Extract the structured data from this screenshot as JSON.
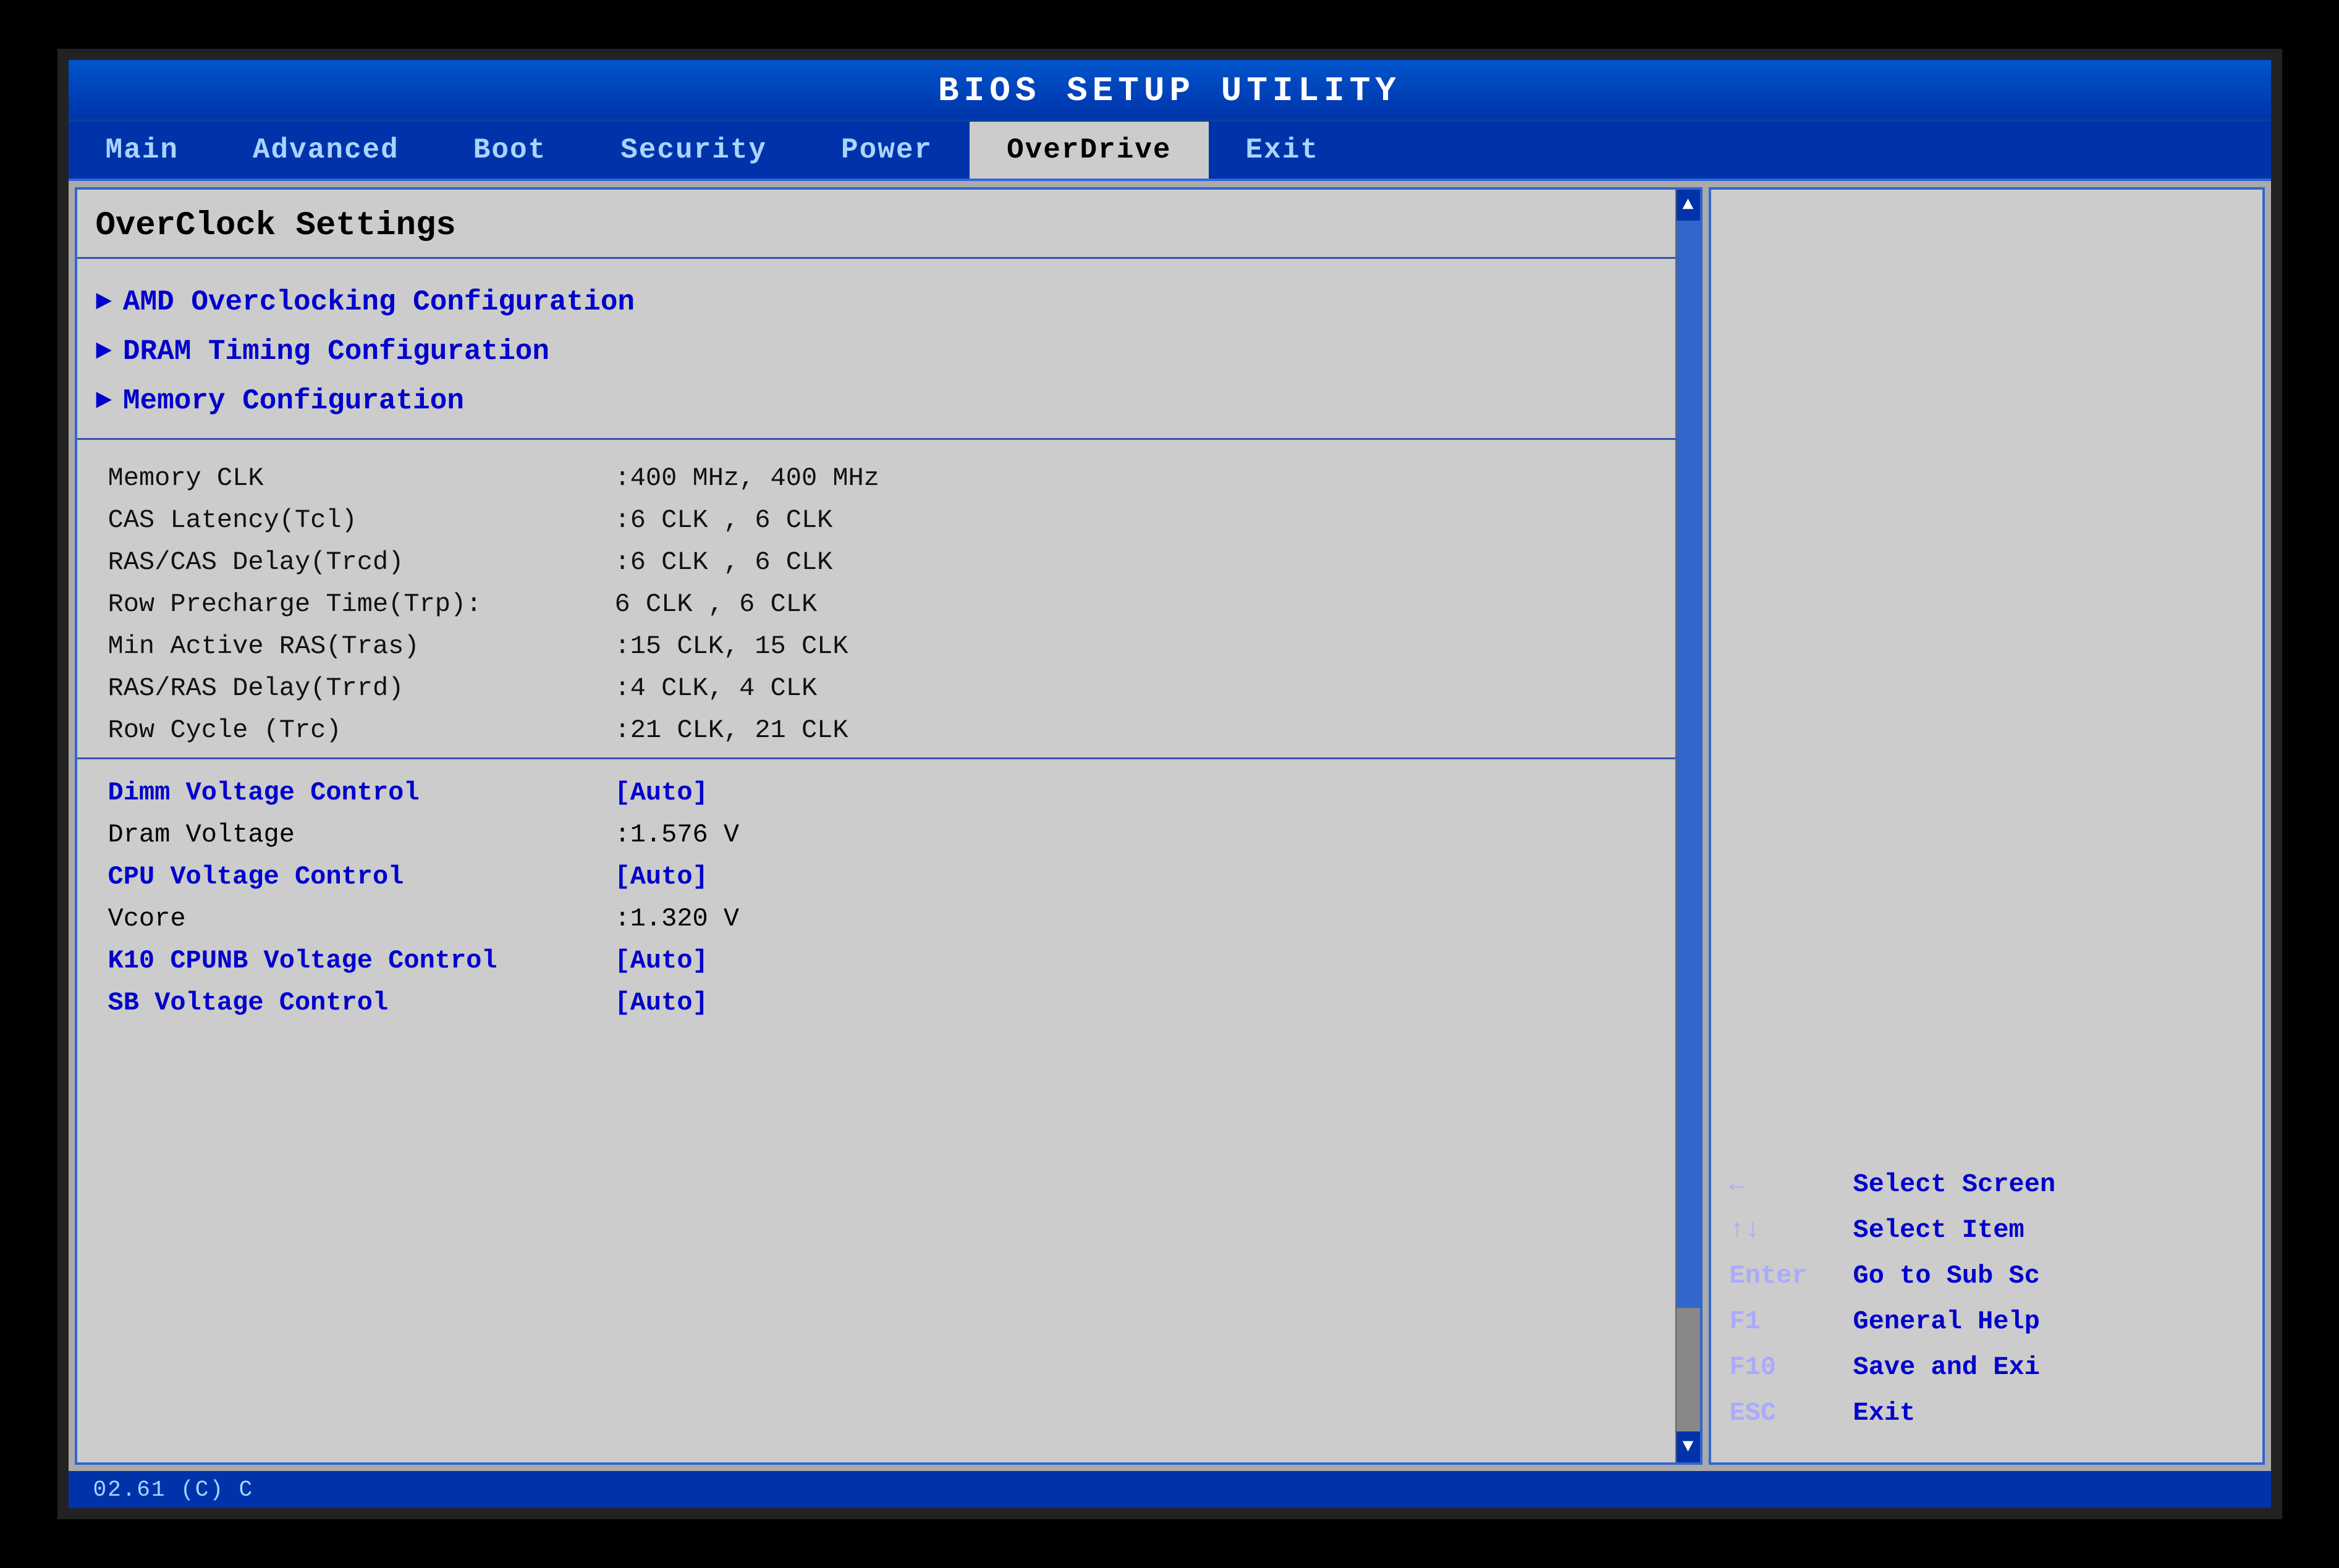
{
  "title": "BIOS SETUP UTILITY",
  "nav": {
    "tabs": [
      {
        "label": "Main",
        "active": false
      },
      {
        "label": "Advanced",
        "active": false
      },
      {
        "label": "Boot",
        "active": false
      },
      {
        "label": "Security",
        "active": false
      },
      {
        "label": "Power",
        "active": false
      },
      {
        "label": "OverDrive",
        "active": true
      },
      {
        "label": "Exit",
        "active": false
      }
    ]
  },
  "main_panel": {
    "title": "OverClock Settings",
    "submenus": [
      {
        "label": "AMD Overclocking Configuration"
      },
      {
        "label": "DRAM Timing Configuration"
      },
      {
        "label": "Memory Configuration"
      }
    ],
    "settings": [
      {
        "label": "Memory CLK",
        "value": ":400 MHz, 400 MHz"
      },
      {
        "label": "CAS Latency(Tcl)",
        "value": ":6 CLK , 6 CLK"
      },
      {
        "label": "RAS/CAS Delay(Trcd)",
        "value": ":6 CLK , 6 CLK"
      },
      {
        "label": "Row Precharge Time(Trp):",
        "value": "6 CLK , 6 CLK"
      },
      {
        "label": "Min Active RAS(Tras)",
        "value": ":15 CLK, 15 CLK"
      },
      {
        "label": "RAS/RAS Delay(Trrd)",
        "value": ":4 CLK, 4 CLK"
      },
      {
        "label": "Row Cycle (Trc)",
        "value": ":21 CLK, 21 CLK"
      }
    ],
    "voltages": [
      {
        "label": "Dimm Voltage Control",
        "value": "[Auto]",
        "label_blue": true,
        "value_blue": true
      },
      {
        "label": "Dram Voltage",
        "value": ":1.576 V",
        "label_blue": false,
        "value_blue": false
      },
      {
        "label": "CPU Voltage Control",
        "value": "[Auto]",
        "label_blue": true,
        "value_blue": true
      },
      {
        "label": "Vcore",
        "value": ":1.320 V",
        "label_blue": false,
        "value_blue": false
      },
      {
        "label": "K10 CPUNB Voltage Control",
        "value": "[Auto]",
        "label_blue": true,
        "value_blue": true
      },
      {
        "label": "SB Voltage Control",
        "value": "[Auto]",
        "label_blue": true,
        "value_blue": true
      }
    ]
  },
  "legend": [
    {
      "key": "←",
      "desc": "Select Screen"
    },
    {
      "key": "↑↓",
      "desc": "Select Item"
    },
    {
      "key": "Enter",
      "desc": "Go to Sub Sc"
    },
    {
      "key": "F1",
      "desc": "General Help"
    },
    {
      "key": "F10",
      "desc": "Save and Exi"
    },
    {
      "key": "ESC",
      "desc": "Exit"
    }
  ],
  "bottom_bar": {
    "text": "02.61 (C) C"
  }
}
